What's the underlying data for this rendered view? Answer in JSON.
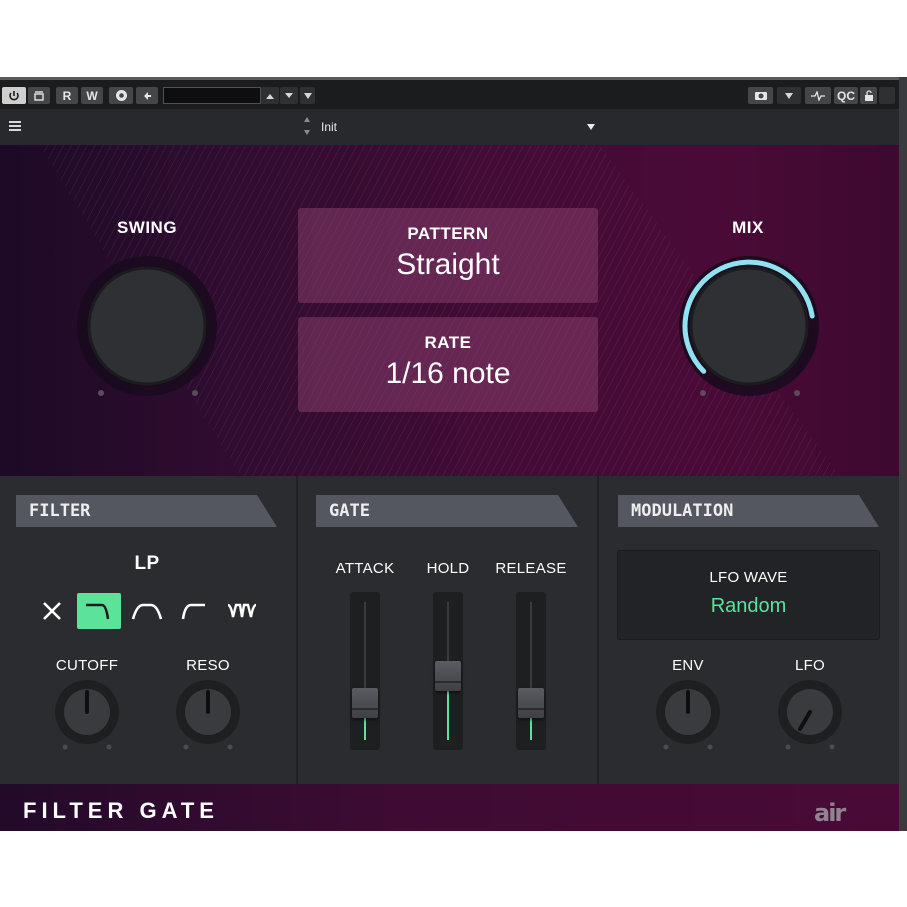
{
  "host": {
    "buttons": [
      "R",
      "W",
      "QC"
    ],
    "preset_name": "Init"
  },
  "hero": {
    "swing_label": "SWING",
    "mix_label": "MIX",
    "pattern_label": "PATTERN",
    "pattern_value": "Straight",
    "rate_label": "RATE",
    "rate_value": "1/16 note",
    "mix_level": 0.8
  },
  "filter": {
    "title": "FILTER",
    "type_label": "LP",
    "cutoff_label": "CUTOFF",
    "reso_label": "RESO"
  },
  "gate": {
    "title": "GATE",
    "attack_label": "ATTACK",
    "hold_label": "HOLD",
    "release_label": "RELEASE",
    "attack_level": 0.2,
    "hold_level": 0.45,
    "release_level": 0.2
  },
  "modulation": {
    "title": "MODULATION",
    "lfo_wave_label": "LFO WAVE",
    "lfo_wave_value": "Random",
    "env_label": "ENV",
    "lfo_label": "LFO"
  },
  "footer": {
    "title": "FILTER GATE",
    "brand": "air"
  },
  "colors": {
    "accent_green": "#5be39a",
    "mix_ring": "#8fe3f0",
    "header_gray": "#545660"
  }
}
